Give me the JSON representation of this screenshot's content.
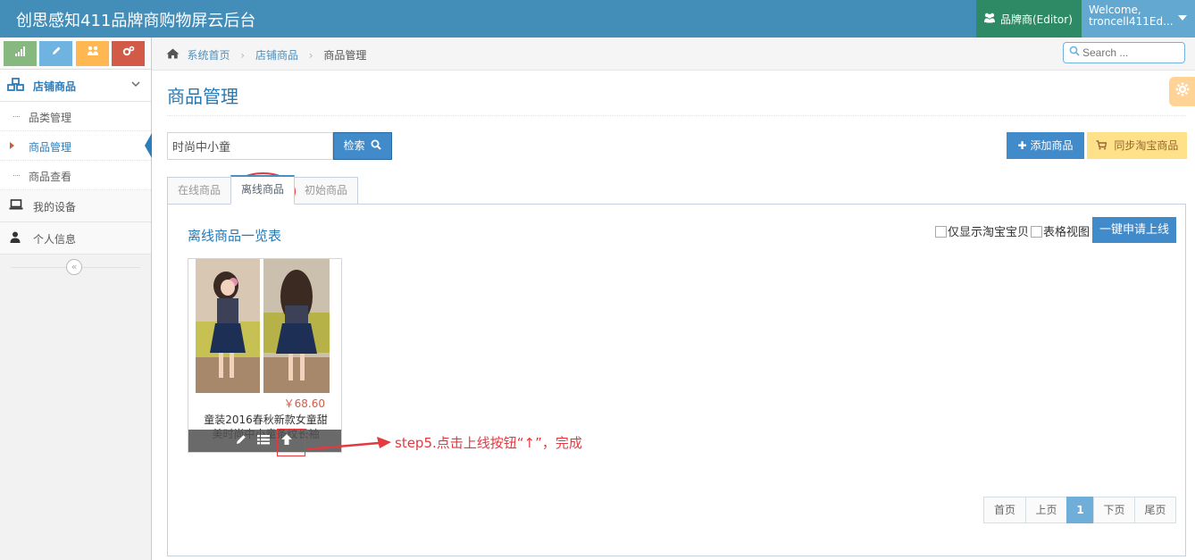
{
  "app": {
    "title": "创思感知411品牌商购物屏云后台",
    "role_label": "品牌商(Editor)",
    "welcome": "Welcome,",
    "username": "troncell411Ed..."
  },
  "colors": {
    "navbar": "#438eb9",
    "role": "#2e8965",
    "primary_button": "#428bca",
    "warning_button": "#fee188",
    "annotation_red": "#e3393f",
    "price_red": "#d15b47"
  },
  "sidebar": {
    "shortcuts": [
      {
        "icon": "signal-icon",
        "color": "#87b87f"
      },
      {
        "icon": "pencil-icon",
        "color": "#6fb3e0"
      },
      {
        "icon": "group-icon",
        "color": "#ffb752"
      },
      {
        "icon": "cogs-icon",
        "color": "#d15b47"
      }
    ],
    "parent": {
      "label": "店铺商品",
      "icon": "cubes-icon"
    },
    "sub_items": [
      {
        "label": "品类管理",
        "active": false
      },
      {
        "label": "商品管理",
        "active": true
      },
      {
        "label": "商品查看",
        "active": false
      }
    ],
    "items": [
      {
        "label": "我的设备",
        "icon": "laptop-icon"
      },
      {
        "label": "个人信息",
        "icon": "user-icon"
      }
    ]
  },
  "breadcrumb": {
    "home": "系统首页",
    "level2": "店铺商品",
    "current": "商品管理"
  },
  "search": {
    "placeholder": "Search ..."
  },
  "page": {
    "title": "商品管理"
  },
  "toolbar": {
    "keyword_value": "时尚中小童",
    "search_label": "检索",
    "add_label": "添加商品",
    "sync_label": "同步淘宝商品"
  },
  "tabs": [
    {
      "label": "在线商品",
      "active": false
    },
    {
      "label": "离线商品",
      "active": true
    },
    {
      "label": "初始商品",
      "active": false
    }
  ],
  "list": {
    "title": "离线商品一览表",
    "only_taobao_label": "仅显示淘宝宝贝",
    "table_view_label": "表格视图",
    "apply_online_label": "一键申请上线"
  },
  "products": [
    {
      "price": "￥68.60",
      "name": "童装2016春秋新款女童甜美时尚中小童条纹长袖"
    }
  ],
  "annotation": {
    "text": "step5.点击上线按钮“↑”，完成"
  },
  "pagination": {
    "first": "首页",
    "prev": "上页",
    "current": "1",
    "next": "下页",
    "last": "尾页"
  }
}
